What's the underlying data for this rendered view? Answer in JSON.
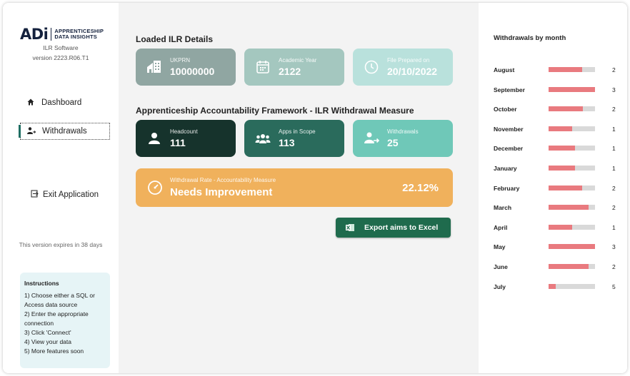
{
  "sidebar": {
    "logo_main": "ADi",
    "logo_line1": "APPRENTICESHIP",
    "logo_line2": "DATA INSIGHTS",
    "software": "ILR Software",
    "version": "version 2223.R06.T1",
    "nav": {
      "dashboard": "Dashboard",
      "withdrawals": "Withdrawals",
      "exit": "Exit Application"
    },
    "expires": "This version expires in 38 days",
    "instructions": {
      "title": "Instructions",
      "lines": [
        "1) Choose either a SQL or",
        "Access data source",
        "2) Enter the appropriate",
        "connection",
        "3) Click 'Connect'",
        "4) View your data",
        "5) More features soon"
      ]
    }
  },
  "main": {
    "loaded_title": "Loaded ILR Details",
    "ukprn": {
      "label": "UKPRN",
      "value": "10000000"
    },
    "academic_year": {
      "label": "Academic Year",
      "value": "2122"
    },
    "file_prepared": {
      "label": "File Prepared on",
      "value": "20/10/2022"
    },
    "aaf_title": "Apprenticeship Accountability Framework - ILR Withdrawal Measure",
    "headcount": {
      "label": "Headcount",
      "value": "111"
    },
    "apps_in_scope": {
      "label": "Apps in Scope",
      "value": "113"
    },
    "withdrawals": {
      "label": "Withdrawals",
      "value": "25"
    },
    "rate": {
      "label": "Withdrawal Rate - Accountability Measure",
      "status": "Needs Improvement",
      "percent": "22.12%"
    },
    "export_label": "Export aims to Excel"
  },
  "colors": {
    "ukprn": "#90a6a2",
    "year": "#a4c7bf",
    "file": "#b9e1dc",
    "headcount": "#16332c",
    "apps": "#2a6b5c",
    "withdrawals": "#6fc8b8",
    "rate": "#f0b15c",
    "bar_fill": "#e97a7f",
    "bar_track": "#d9d9d9"
  },
  "withdrawals_by_month": {
    "title": "Withdrawals by month",
    "months": [
      {
        "name": "August",
        "value": "2",
        "fill": 0.72
      },
      {
        "name": "September",
        "value": "3",
        "fill": 1.0
      },
      {
        "name": "October",
        "value": "2",
        "fill": 0.74
      },
      {
        "name": "November",
        "value": "1",
        "fill": 0.5
      },
      {
        "name": "December",
        "value": "1",
        "fill": 0.57
      },
      {
        "name": "January",
        "value": "1",
        "fill": 0.57
      },
      {
        "name": "February",
        "value": "2",
        "fill": 0.72
      },
      {
        "name": "March",
        "value": "2",
        "fill": 0.86
      },
      {
        "name": "April",
        "value": "1",
        "fill": 0.5
      },
      {
        "name": "May",
        "value": "3",
        "fill": 1.0
      },
      {
        "name": "June",
        "value": "2",
        "fill": 0.86
      },
      {
        "name": "July",
        "value": "5",
        "fill": 0.16
      }
    ]
  }
}
